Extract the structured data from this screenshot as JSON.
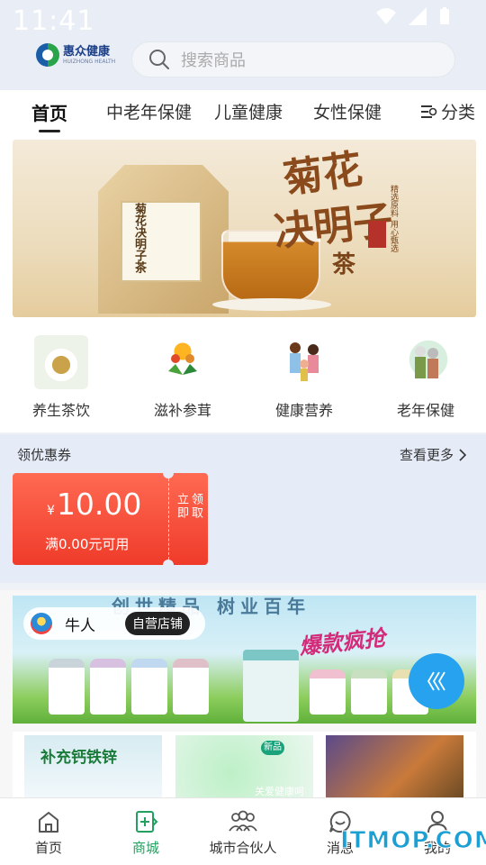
{
  "status_bar": {
    "time": "11:41"
  },
  "header": {
    "logo_cn": "惠众健康",
    "logo_en": "HUIZHONG HEALTH",
    "search_placeholder": "搜索商品",
    "search_icon": "search-icon"
  },
  "tabs": [
    {
      "label": "首页",
      "active": true
    },
    {
      "label": "中老年保健"
    },
    {
      "label": "儿童健康"
    },
    {
      "label": "女性保健"
    }
  ],
  "category_button": {
    "label": "分类",
    "icon": "category-list-icon"
  },
  "banner": {
    "headline_1": "菊花",
    "headline_2": "决明子",
    "headline_3": "茶",
    "package_text": "菊花决明子茶",
    "side_text": "精选原料 用心甄选"
  },
  "categories": [
    {
      "label": "养生茶饮",
      "icon": "tea-cup-icon"
    },
    {
      "label": "滋补参茸",
      "icon": "wellness-sun-icon"
    },
    {
      "label": "健康营养",
      "icon": "family-icon"
    },
    {
      "label": "老年保健",
      "icon": "elderly-couple-icon"
    }
  ],
  "coupons": {
    "title": "领优惠券",
    "more_label": "查看更多",
    "items": [
      {
        "currency": "¥",
        "amount": "10.00",
        "condition": "满0.00元可用",
        "claim_label": [
          "立即",
          "领取"
        ]
      }
    ]
  },
  "store": {
    "name": "牛人",
    "badge": "自营店铺",
    "slogan": "创世精品  树业百年",
    "promo": "爆款疯抢",
    "thumb1_text": "补充钙铁锌",
    "thumb2_badge": "新品",
    "thumb2_text": "关爱健康呵护"
  },
  "bottom_nav": [
    {
      "label": "首页",
      "icon": "home-icon"
    },
    {
      "label": "商城",
      "icon": "shop-icon",
      "active": true
    },
    {
      "label": "城市合伙人",
      "icon": "partners-icon"
    },
    {
      "label": "消息",
      "icon": "message-icon"
    },
    {
      "label": "我的",
      "icon": "profile-icon"
    }
  ],
  "watermark": "ITMOP.COM",
  "colors": {
    "accent_green": "#22a060",
    "coupon_red": "#ef3b2a",
    "float_button_blue": "#27a2ee",
    "tab_underline": "#222222"
  }
}
